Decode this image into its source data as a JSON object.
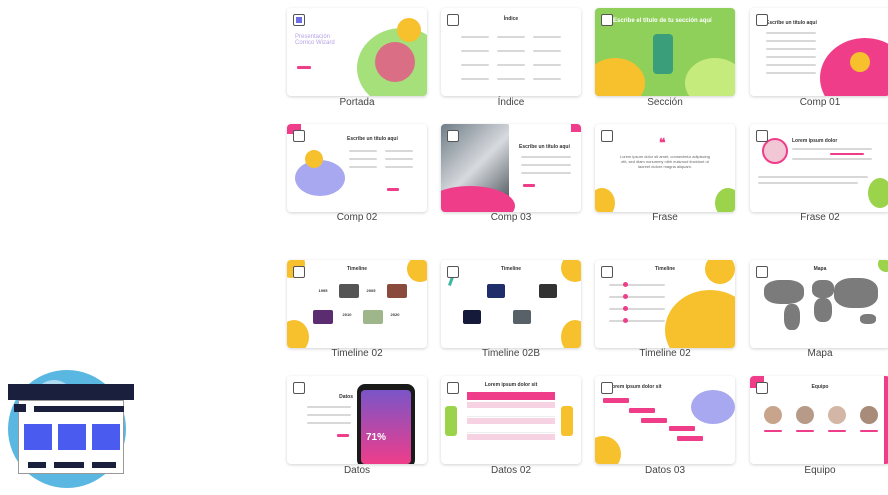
{
  "colors": {
    "accent": "#ef3d8a",
    "green": "#9bd34a",
    "yellow": "#f6c12d",
    "selected": "#6e6ee6",
    "logo_blue": "#4a5bf0",
    "logo_circle": "#5ab7e2"
  },
  "slides": [
    {
      "caption": "Portada",
      "checked": true,
      "title": "Presentación Corrico Wizard"
    },
    {
      "caption": "Índice",
      "checked": false,
      "title": "Índice"
    },
    {
      "caption": "Sección",
      "checked": false,
      "title": "Escribe el título de tu sección aquí"
    },
    {
      "caption": "Comp 01",
      "checked": false,
      "title": "Escribe un título aquí"
    },
    {
      "caption": "Comp 02",
      "checked": false,
      "title": "Escribe un título aquí"
    },
    {
      "caption": "Comp 03",
      "checked": false,
      "title": "Escribe un título aquí"
    },
    {
      "caption": "Frase",
      "checked": false,
      "title": "Lorem ipsum dolor sit amet, consectetur adipiscing elit, sed diam nonummy nibh euismod tincidunt ut laoreet dolore magna aliquam."
    },
    {
      "caption": "Frase 02",
      "checked": false,
      "title": "Lorem ipsum dolor"
    },
    {
      "caption": "Timeline 02",
      "checked": false,
      "title": "Timeline"
    },
    {
      "caption": "Timeline 02B",
      "checked": false,
      "title": "Timeline"
    },
    {
      "caption": "Timeline 02",
      "checked": false,
      "title": "Timeline"
    },
    {
      "caption": "Mapa",
      "checked": false,
      "title": "Mapa"
    },
    {
      "caption": "Datos",
      "checked": false,
      "title": "Datos",
      "stat": "71%"
    },
    {
      "caption": "Datos 02",
      "checked": false,
      "title": "Lorem ipsum dolor sit"
    },
    {
      "caption": "Datos 03",
      "checked": false,
      "title": "Lorem ipsum dolor sit"
    },
    {
      "caption": "Equipo",
      "checked": false,
      "title": "Equipo"
    }
  ],
  "timeline_years": [
    "1995",
    "2005",
    "2010",
    "2020"
  ]
}
